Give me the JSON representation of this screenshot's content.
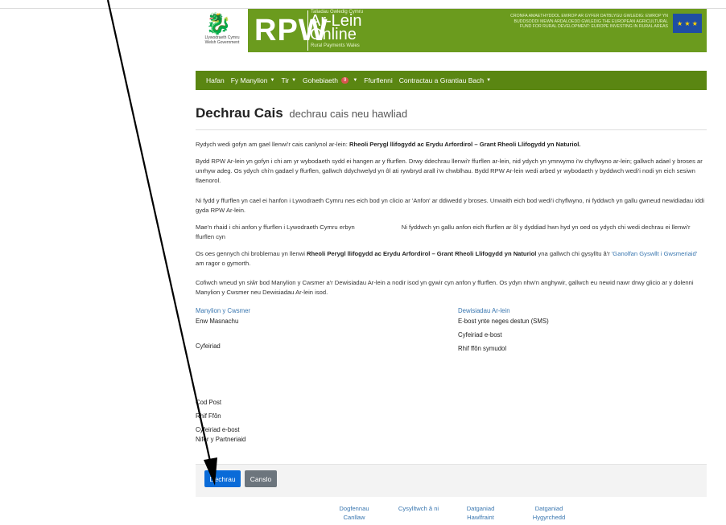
{
  "header": {
    "wg_logo_text": "Llywodraeth Cymru Welsh Government",
    "rpw_logo": "RPW",
    "al_small": "Taliadau Gwledig Cymru",
    "al_big_1": "Ar-Lein",
    "al_big_2": "Online",
    "al_sub": "Rural Payments Wales",
    "eu_text": "CRONFA AMAETHYDDOL EWROP AR GYFER DATBLYGU GWLEDIG: EWROP YN BUDDSODDI MEWN ARDALOEDD GWLEDIG THE EUROPEAN AGRICULTURAL FUND FOR RURAL DEVELOPMENT: EUROPE INVESTING IN RURAL AREAS",
    "eu_flag_icon": "eu-flag-icon"
  },
  "nav": {
    "home": "Hafan",
    "my_details": "Fy Manylion",
    "land": "Tir",
    "correspondence": "Gohebiaeth",
    "correspondence_count": "9",
    "forms": "Ffurflenni",
    "contracts": "Contractau a Grantiau Bach"
  },
  "page": {
    "title": "Dechrau Cais",
    "subtitle": "dechrau cais neu hawliad"
  },
  "body": {
    "p1_pre": "Rydych wedi gofyn am gael llenwi'r cais canlynol ar-lein: ",
    "p1_bold": "Rheoli Perygl llifogydd ac Erydu Arfordirol – Grant Rheoli Llifogydd yn Naturiol.",
    "p2": "Bydd RPW Ar-lein yn gofyn i chi am yr wybodaeth sydd ei hangen ar y ffurflen. Drwy ddechrau llenwi'r ffurflen ar-lein, nid ydych yn ymrwymo i'w chyflwyno ar-lein; gallwch adael y broses ar unrhyw adeg. Os ydych chi'n gadael y ffurflen, gallwch ddychwelyd yn ôl ati rywbryd arall i'w chwblhau. Bydd RPW Ar-lein wedi arbed yr wybodaeth y byddwch wedi'i nodi yn eich sesiwn flaenorol.",
    "p3": "Ni fydd y ffurflen yn cael ei hanfon i Lywodraeth Cymru nes eich bod yn clicio ar 'Anfon' ar ddiwedd y broses. Unwaith eich bod wedi'i chyflwyno, ni fyddwch yn gallu gwneud newidiadau iddi gyda RPW Ar-lein.",
    "p4_a": "Mae'n rhaid i chi anfon y ffurflen i Lywodraeth Cymru erbyn",
    "p4_b": "Ni fyddwch yn gallu anfon eich ffurflen ar ôl y dyddiad hwn hyd yn oed os ydych chi wedi dechrau ei llenwi'r ffurflen cyn",
    "p5_pre": "Os oes gennych chi broblemau yn llenwi ",
    "p5_bold": "Rheoli Perygl llifogydd ac Erydu Arfordirol – Grant Rheoli Llifogydd yn Naturiol",
    "p5_mid": " yna gallwch chi gysylltu â'r ",
    "p5_link": "'Ganolfan Gyswllt i Gwsmeriaid'",
    "p5_post": " am ragor o gymorth.",
    "p6": "Cofiwch wneud yn siŵr bod Manylion y Cwsmer a'r Dewisiadau Ar-lein a nodir isod yn gywir cyn anfon y ffurflen. Os ydyn nhw'n anghywir, gallwch eu newid nawr drwy glicio ar y dolenni Manylion y Cwsmer neu Dewisiadau Ar-lein isod."
  },
  "details": {
    "customer_link": "Manylion y Cwsmer",
    "trading_name": "Enw Masnachu",
    "address": "Cyfeiriad",
    "postcode": "Cod Post",
    "phone": "Rhif Ffôn",
    "email": "Cyfeiriad e-bost",
    "partners": "Nifer y Partneriaid",
    "online_link": "Dewisiadau Ar-lein",
    "sms": "E-bost ynte neges destun (SMS)",
    "online_email": "Cyfeiriad e-bost",
    "mobile": "Rhif ffôn symudol"
  },
  "actions": {
    "start": "Dechrau",
    "cancel": "Canslo"
  },
  "footer": {
    "docs_1": "Dogfennau",
    "docs_2": "Canllaw",
    "contact": "Cysylltwch â ni",
    "privacy_1": "Datganiad",
    "privacy_2": "Hawlfraint",
    "access_1": "Datganiad",
    "access_2": "Hygyrchedd"
  },
  "colors": {
    "banner": "#6b9b1e",
    "navbar": "#5a8612",
    "primary": "#0a6bd8",
    "secondary": "#6c757d",
    "link": "#3a77b0"
  }
}
